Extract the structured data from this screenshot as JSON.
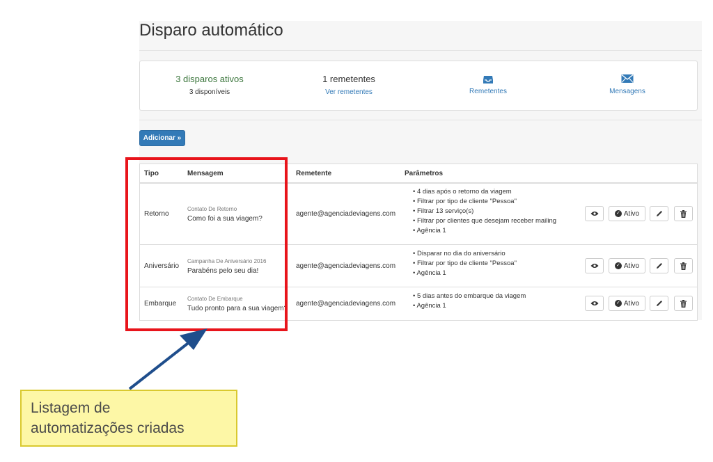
{
  "page": {
    "title": "Disparo automático"
  },
  "stats": {
    "active": "3 disparos ativos",
    "available": "3 disponíveis",
    "senders_count": "1 remetentes",
    "view_senders": "Ver remetentes",
    "senders_label": "Remetentes",
    "messages_label": "Mensagens",
    "senders_icon": "inbox-tray-icon",
    "messages_icon": "envelope-icon"
  },
  "toolbar": {
    "add_label": "Adicionar »"
  },
  "table": {
    "headers": [
      "Tipo",
      "Mensagem",
      "Remetente",
      "Parâmetros"
    ],
    "rows": [
      {
        "tipo": "Retorno",
        "msg_sub": "Contato De Retorno",
        "msg_main": "Como foi a sua viagem?",
        "remetente": "agente@agenciadeviagens.com",
        "params": [
          "4 dias após o retorno da viagem",
          "Filtrar por tipo de cliente \"Pessoa\"",
          "Filtrar 13 serviço(s)",
          "Filtrar por clientes que desejam receber mailing",
          "Agência 1"
        ],
        "status": "Ativo"
      },
      {
        "tipo": "Aniversário",
        "msg_sub": "Campanha De Aniversário 2016",
        "msg_main": "Parabéns pelo seu dia!",
        "remetente": "agente@agenciadeviagens.com",
        "params": [
          "Disparar no dia do aniversário",
          "Filtrar por tipo de cliente \"Pessoa\"",
          "Agência 1"
        ],
        "status": "Ativo"
      },
      {
        "tipo": "Embarque",
        "msg_sub": "Contato De Embarque",
        "msg_main": "Tudo pronto para a sua viagem?",
        "remetente": "agente@agenciadeviagens.com",
        "params": [
          "5 dias antes do embarque da viagem",
          "Agência 1"
        ],
        "status": "Ativo"
      }
    ]
  },
  "annotation": {
    "callout_line1": "Listagem de",
    "callout_line2": "automatizações criadas",
    "highlight_color": "#e8141b",
    "arrow_color": "#1f4e8c",
    "callout_bg": "#fdf7a6"
  }
}
